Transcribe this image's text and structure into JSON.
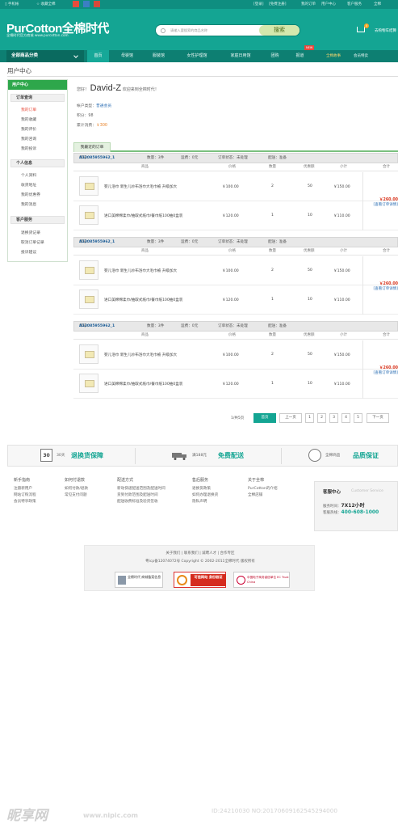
{
  "topbar": {
    "mobile": "手机帐",
    "favorite": "收藏全棉",
    "login": "[登录]",
    "register": "[免费注册]",
    "my_orders": "我的订单",
    "user_center": "用户中心",
    "customer_service": "客户服务",
    "more": "全棉"
  },
  "header": {
    "logo": "PurCotton全棉时代",
    "slogan": "全棉时代官方商城 www.purcotton.com",
    "search_placeholder": "请输入要搜索的商品名称",
    "search_button": "搜索",
    "cart_count": "0",
    "cart_label": "去购物车结算"
  },
  "nav": {
    "all_categories": "全部商品分类",
    "items": [
      "首页",
      "母婴馆",
      "服装馆",
      "女性护理馆",
      "家庭日用馆",
      "团购",
      "报道",
      "全棉故事",
      "会员特卖"
    ],
    "new_badge": "NEW"
  },
  "page_title": "用户中心",
  "sidebar": {
    "header": "用户中心",
    "sections": [
      {
        "title": "订单查询",
        "links": [
          "我的订单",
          "我的收藏",
          "我的评价",
          "我的咨询",
          "我的投诉"
        ]
      },
      {
        "title": "个人信息",
        "links": [
          "个人资料",
          "收货地址",
          "我的优惠券",
          "我的消息"
        ]
      },
      {
        "title": "客户服务",
        "links": [
          "退换货记录",
          "取消订单记录",
          "投诉建议"
        ]
      }
    ]
  },
  "welcome": {
    "greeting": "您好！",
    "username": "David-Z",
    "suffix": "欢迎来到全棉时代！",
    "account_type_label": "帐户类型：",
    "account_type": "普通会员",
    "points_label": "积分：98",
    "spend_label": "累计消费：",
    "spend_value": "￥300"
  },
  "recent_tab": "我最近的订单",
  "columns": {
    "product": "商品",
    "price": "价格",
    "qty": "数量",
    "discount": "优惠额",
    "subtotal": "小计",
    "total": "合计"
  },
  "orders": [
    {
      "no_label": "单号：",
      "no": "A13085955962_1",
      "count": "数量：3件",
      "shipping": "运费：0元",
      "status": "订单状态：未处理",
      "delivery": "配送：准备",
      "items": [
        {
          "name": "婴儿浴巾 新生儿纱布浴巾大毛巾被 升级加大",
          "price": "￥100.00",
          "qty": "2",
          "discount": "50",
          "subtotal": "￥150.00"
        },
        {
          "name": "进口美棉棉柔巾/抽取式纸巾/餐巾纸100抽0盒装",
          "price": "￥120.00",
          "qty": "1",
          "discount": "10",
          "subtotal": "￥110.00"
        }
      ],
      "total": "￥260.00",
      "detail": "[查看订单详情]"
    },
    {
      "no_label": "单号：",
      "no": "A13085955962_1",
      "count": "数量：3件",
      "shipping": "运费：0元",
      "status": "订单状态：未处理",
      "delivery": "配送：准备",
      "items": [
        {
          "name": "婴儿浴巾 新生儿纱布浴巾大毛巾被 升级加大",
          "price": "￥100.00",
          "qty": "2",
          "discount": "50",
          "subtotal": "￥150.00"
        },
        {
          "name": "进口美棉棉柔巾/抽取式纸巾/餐巾纸100抽0盒装",
          "price": "￥120.00",
          "qty": "1",
          "discount": "10",
          "subtotal": "￥110.00"
        }
      ],
      "total": "￥260.00",
      "detail": "[查看订单详情]"
    },
    {
      "no_label": "单号：",
      "no": "A13085955962_1",
      "count": "数量：3件",
      "shipping": "运费：0元",
      "status": "订单状态：未处理",
      "delivery": "配送：准备",
      "items": [
        {
          "name": "婴儿浴巾 新生儿纱布浴巾大毛巾被 升级加大",
          "price": "￥100.00",
          "qty": "2",
          "discount": "50",
          "subtotal": "￥150.00"
        },
        {
          "name": "进口美棉棉柔巾/抽取式纸巾/餐巾纸100抽0盒装",
          "price": "￥120.00",
          "qty": "1",
          "discount": "10",
          "subtotal": "￥110.00"
        }
      ],
      "total": "￥260.00",
      "detail": "[查看订单详情]"
    }
  ],
  "pager": {
    "info": "1/共5页",
    "first": "首页",
    "prev": "上一页",
    "pages": [
      "1",
      "2",
      "3",
      "4",
      "5"
    ],
    "next": "下一页"
  },
  "services": [
    {
      "icon_text": "30",
      "t1": "30天",
      "t2": "退换货保障"
    },
    {
      "t1": "满188元",
      "t2": "免费配送"
    },
    {
      "t1": "全棉商品",
      "t2": "品质保证"
    }
  ],
  "footer_links": [
    {
      "title": "新手指南",
      "links": [
        "注册新用户",
        "网站订购流程",
        "会员特享政策"
      ]
    },
    {
      "title": "如何付退款",
      "links": [
        "如何付款/退款",
        "常见支付问题"
      ]
    },
    {
      "title": "配送方式",
      "links": [
        "新动快递配送范围及配送时间",
        "货到付款范围及配送时间",
        "配送收费标准及验货签收"
      ]
    },
    {
      "title": "售后服务",
      "links": [
        "退换货政策",
        "如何办理退换货",
        "隐私声明"
      ]
    },
    {
      "title": "关于全棉",
      "links": [
        "PurCotton的介绍",
        "全棉店铺"
      ]
    }
  ],
  "cs": {
    "title": "客服中心",
    "title_en": "Customer Service",
    "hours_label": "服务时间：",
    "hours": "7X12小时",
    "phone_label": "客服热线：",
    "phone": "400-608-1000"
  },
  "bottom_footer": {
    "links": "关于我们 | 联系我们 | 诚聘人才 | 合作专区",
    "copyright": "粤icp备12074072号 Copyright © 2002-2011全棉时代 版权所有",
    "badges": [
      "全棉时代 商城备案信息",
      "可信网站 身份验证",
      "中国电子商务诚信单位 EC Trust China"
    ]
  },
  "watermark": {
    "logo": "昵享网",
    "url": "www.nipic.com",
    "id": "ID:24210030 NO:20170609162545294000"
  }
}
